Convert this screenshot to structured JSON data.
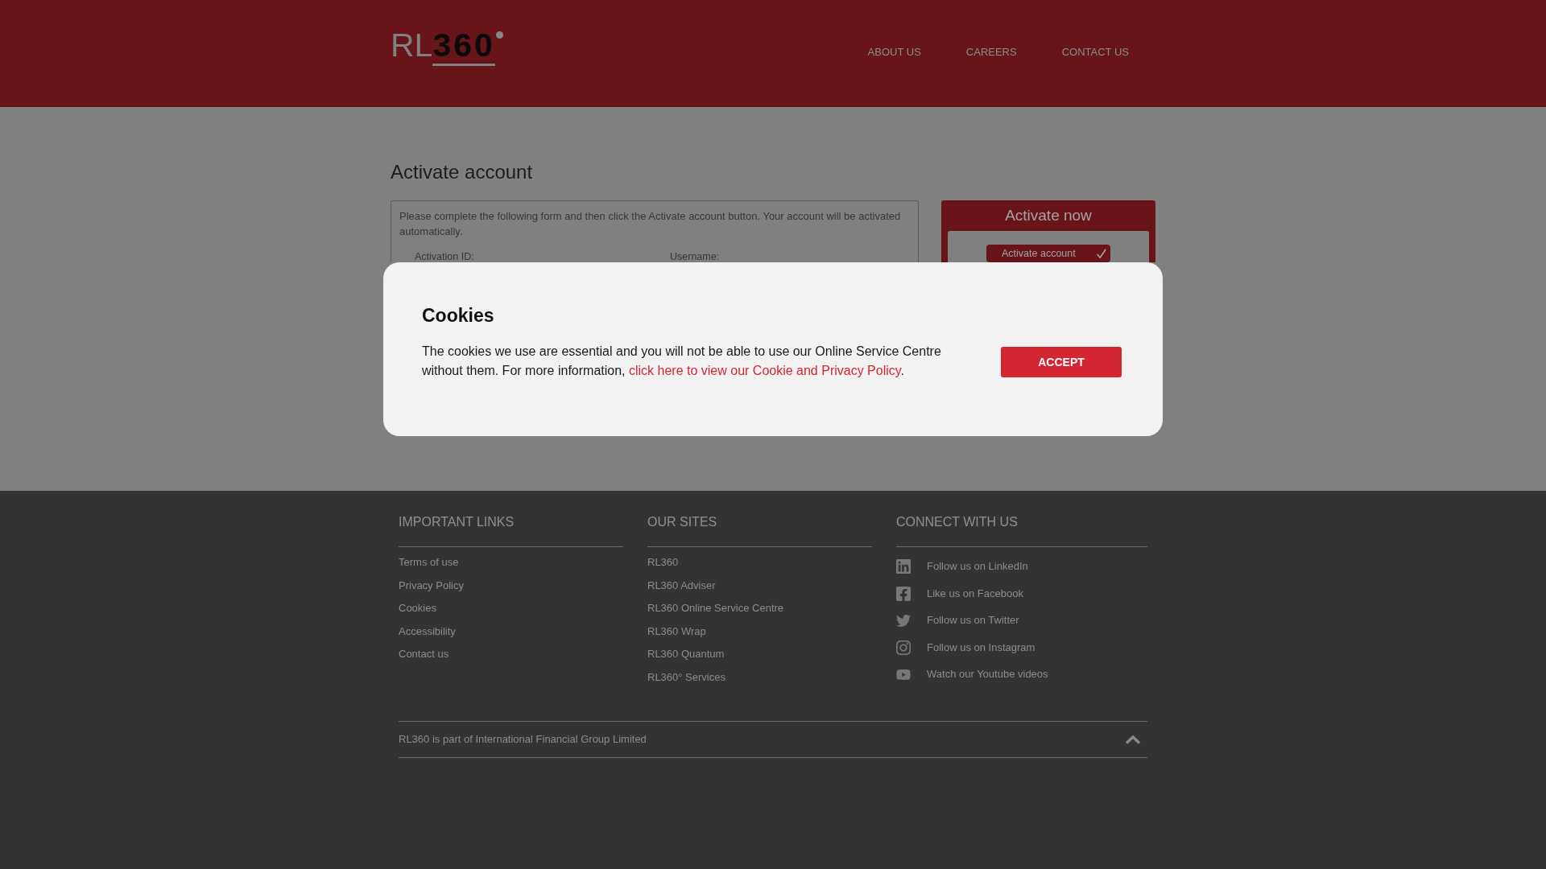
{
  "header": {
    "logo": {
      "light": "RL",
      "bold": "360"
    },
    "nav": [
      {
        "label": "ABOUT US"
      },
      {
        "label": "CAREERS"
      },
      {
        "label": "CONTACT US"
      }
    ]
  },
  "page": {
    "title": "Activate account",
    "form": {
      "intro": "Please complete the following form and then click the Activate account button. Your account will be activated automatically.",
      "fields": [
        {
          "label": "Activation ID:"
        },
        {
          "label": "Username:"
        }
      ]
    },
    "side_panel": {
      "title": "Activate now",
      "button": "Activate account"
    }
  },
  "cookie_dialog": {
    "title": "Cookies",
    "text_before": "The cookies we use are essential and you will not be able to use our Online Service Centre without them. For more information, ",
    "link": "click here to view our Cookie and Privacy Policy",
    "text_after": ".",
    "button": "ACCEPT"
  },
  "footer": {
    "columns": [
      {
        "heading": "IMPORTANT LINKS",
        "kind": "links",
        "items": [
          {
            "label": "Terms of use"
          },
          {
            "label": "Privacy Policy"
          },
          {
            "label": "Cookies"
          },
          {
            "label": "Accessibility"
          },
          {
            "label": "Contact us"
          }
        ]
      },
      {
        "heading": "OUR SITES",
        "kind": "links",
        "items": [
          {
            "label": "RL360"
          },
          {
            "label": "RL360 Adviser"
          },
          {
            "label": "RL360 Online Service Centre"
          },
          {
            "label": "RL360 Wrap"
          },
          {
            "label": "RL360 Quantum"
          },
          {
            "label": "RL360° Services"
          }
        ]
      },
      {
        "heading": "CONNECT WITH US",
        "kind": "social",
        "items": [
          {
            "label": "Follow us on LinkedIn",
            "kind": "linkedin"
          },
          {
            "label": "Like us on Facebook",
            "kind": "facebook"
          },
          {
            "label": "Follow us on Twitter",
            "kind": "twitter"
          },
          {
            "label": "Follow us on Instagram",
            "kind": "instagram"
          },
          {
            "label": "Watch our Youtube videos",
            "kind": "youtube"
          }
        ]
      }
    ],
    "legal": "RL360 is part of International Financial Group Limited"
  }
}
